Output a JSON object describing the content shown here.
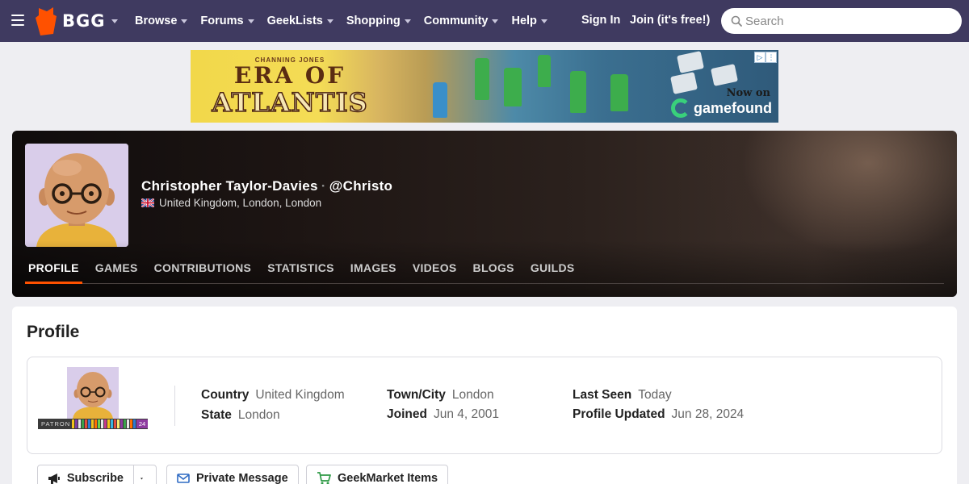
{
  "nav": {
    "logo_text": "BGG",
    "links": [
      "Browse",
      "Forums",
      "GeekLists",
      "Shopping",
      "Community",
      "Help"
    ],
    "sign_in": "Sign In",
    "join": "Join (it's free!)",
    "search_placeholder": "Search"
  },
  "ad": {
    "small": "CHANNING JONES",
    "era": "ERA OF",
    "atlantis": "ATLANTIS",
    "now_on": "Now on",
    "brand": "gamefound"
  },
  "profile_header": {
    "name": "Christopher Taylor-Davies",
    "handle": "@Christo",
    "location": "United Kingdom, London, London",
    "tabs": [
      "PROFILE",
      "GAMES",
      "CONTRIBUTIONS",
      "STATISTICS",
      "IMAGES",
      "VIDEOS",
      "BLOGS",
      "GUILDS"
    ],
    "active_tab": "PROFILE"
  },
  "profile": {
    "title": "Profile",
    "badge_label": "PATRON",
    "badge_year": "24",
    "fields": {
      "country_label": "Country",
      "country": "United Kingdom",
      "state_label": "State",
      "state": "London",
      "town_label": "Town/City",
      "town": "London",
      "joined_label": "Joined",
      "joined": "Jun 4, 2001",
      "last_seen_label": "Last Seen",
      "last_seen": "Today",
      "updated_label": "Profile Updated",
      "updated": "Jun 28, 2024"
    },
    "buttons": {
      "subscribe": "Subscribe",
      "message": "Private Message",
      "geekmarket": "GeekMarket Items"
    }
  },
  "colors": {
    "nav_bg": "#3f3a60",
    "accent": "#ff5100",
    "geekmarket_icon": "#2e9a46",
    "message_icon": "#2f6bc4"
  }
}
